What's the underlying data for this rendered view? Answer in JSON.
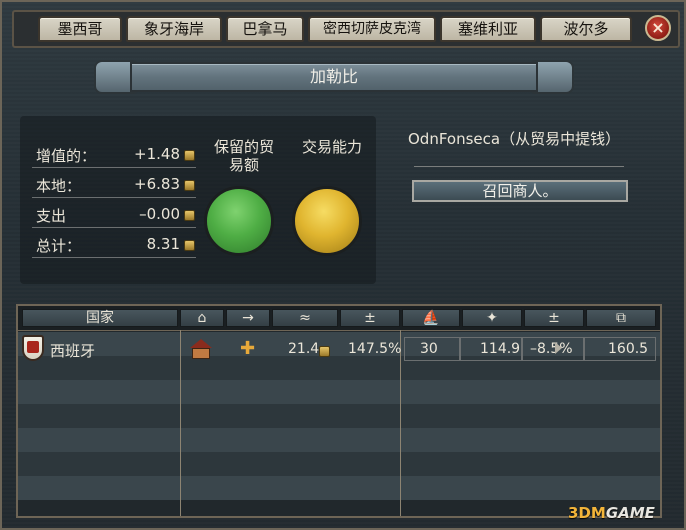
{
  "tabs": [
    "墨西哥",
    "象牙海岸",
    "巴拿马",
    "密西切萨皮克湾",
    "塞维利亚",
    "波尔多"
  ],
  "close_icon": "×",
  "title": "加勒比",
  "summary": {
    "rows": [
      {
        "label": "增值的：",
        "value": "+1.48"
      },
      {
        "label": "本地：",
        "value": "+6.83"
      },
      {
        "label": "支出",
        "value": "–0.00"
      },
      {
        "label": "总计：",
        "value": "8.31"
      }
    ],
    "retained_label_line1": "保留的贸",
    "retained_label_line2": "易额",
    "trade_power_label": "交易能力"
  },
  "colors": {
    "retained": "#4fae45",
    "trade_power": "#e0b52f"
  },
  "merchant": {
    "name": "OdnFonseca（从贸易中提钱）",
    "recall_button": "召回商人。"
  },
  "table": {
    "headers": [
      "国家",
      "⌂",
      "→",
      "≈",
      "±",
      "⛵",
      "✦",
      "±",
      "⧉"
    ],
    "rows": [
      {
        "country": "西班牙",
        "value": "21.4",
        "percent": "147.5%",
        "ships": "30",
        "power": "114.9",
        "change": "–8.5%",
        "total": "160.5"
      }
    ]
  },
  "watermark": {
    "brand": "3DM",
    "rest": "GAME"
  }
}
